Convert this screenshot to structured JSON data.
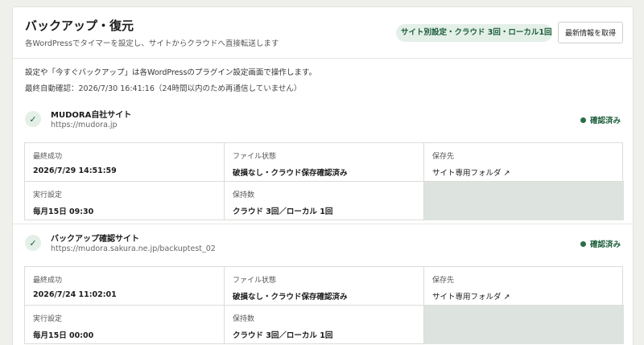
{
  "header": {
    "title": "バックアップ・復元",
    "subtitle": "各WordPressでタイマーを設定し、サイトからクラウドへ直接転送します",
    "badge": "サイト別設定・クラウド 3回・ローカル1回",
    "refresh_label": "最新情報を取得"
  },
  "notice": "設定や「今すぐバックアップ」は各WordPressのプラグイン設定画面で操作します。",
  "last_check": "最終自動確認：2026/7/30 16:41:16（24時間以内のため再通信していません）",
  "labels": {
    "last_success": "最終成功",
    "file_state": "ファイル状態",
    "destination": "保存先",
    "schedule": "実行設定",
    "retention": "保持数"
  },
  "sites": [
    {
      "name": "MUDORA自社サイト",
      "url": "https://mudora.jp",
      "status": "確認済み",
      "last_success": "2026/7/29 14:51:59",
      "file_state": "破損なし・クラウド保存確認済み",
      "destination": "サイト専用フォルダ ↗",
      "schedule": "毎月15日 09:30",
      "retention": "クラウド 3回／ローカル 1回"
    },
    {
      "name": "バックアップ確認サイト",
      "url": "https://mudora.sakura.ne.jp/backuptest_02",
      "status": "確認済み",
      "last_success": "2026/7/24 11:02:01",
      "file_state": "破損なし・クラウド保存確認済み",
      "destination": "サイト専用フォルダ ↗",
      "schedule": "毎月15日 00:00",
      "retention": "クラウド 3回／ローカル 1回"
    }
  ],
  "colors": {
    "accent": "#1d5e3c",
    "badge_bg": "#e4efe8",
    "empty_cell": "#dde4df",
    "page_bg": "#efefec"
  }
}
